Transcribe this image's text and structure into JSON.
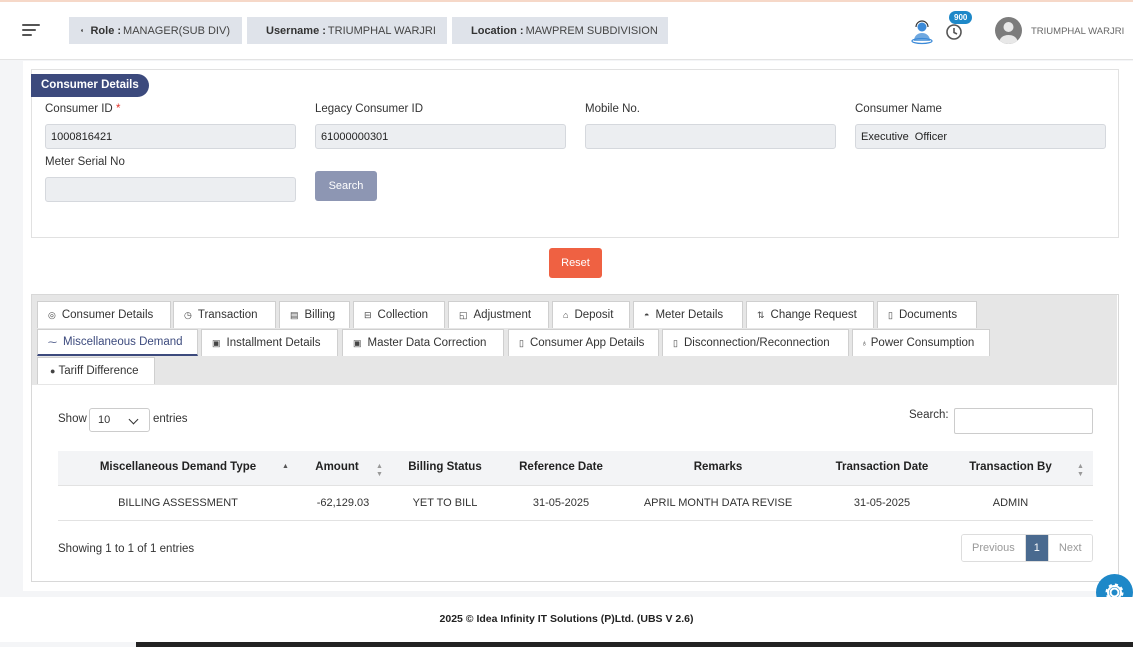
{
  "header": {
    "role_label": "Role :",
    "role_value": "MANAGER(SUB DIV)",
    "username_label": "Username :",
    "username_value": "TRIUMPHAL WARJRI",
    "location_label": "Location :",
    "location_value": "MAWPREM SUBDIVISION",
    "notification_count": "900",
    "user_display": "TRIUMPHAL WARJRI"
  },
  "consumer_details": {
    "title": "Consumer Details",
    "consumer_id_label": "Consumer ID",
    "consumer_id_required": "*",
    "consumer_id_value": "1000816421",
    "legacy_id_label": "Legacy Consumer ID",
    "legacy_id_value": "61000000301",
    "mobile_label": "Mobile No.",
    "mobile_value": "",
    "name_label": "Consumer Name",
    "name_value": "Executive  Officer",
    "meter_label": "Meter Serial No",
    "meter_value": "",
    "search_button": "Search",
    "reset_button": "Reset"
  },
  "tabs": [
    {
      "label": "Consumer Details",
      "icon": "◎"
    },
    {
      "label": "Transaction",
      "icon": "◷"
    },
    {
      "label": "Billing",
      "icon": "▤"
    },
    {
      "label": "Collection",
      "icon": "⊟"
    },
    {
      "label": "Adjustment",
      "icon": "◱"
    },
    {
      "label": "Deposit",
      "icon": "⌂"
    },
    {
      "label": "Meter Details",
      "icon": "◓"
    },
    {
      "label": "Change Request",
      "icon": "⇅"
    },
    {
      "label": "Documents",
      "icon": "▯"
    },
    {
      "label": "Miscellaneous Demand",
      "icon": "⁓",
      "active": true
    },
    {
      "label": "Installment Details",
      "icon": "▣"
    },
    {
      "label": "Master Data Correction",
      "icon": "▣"
    },
    {
      "label": "Consumer App Details",
      "icon": "▯"
    },
    {
      "label": "Disconnection/Reconnection",
      "icon": "▯"
    },
    {
      "label": "Power Consumption",
      "icon": "♁"
    },
    {
      "label": "Tariff Difference",
      "icon": "●"
    }
  ],
  "table": {
    "show_label": "Show",
    "entries_value": "10",
    "entries_label": "entries",
    "search_label": "Search:",
    "search_value": "",
    "columns": [
      "Miscellaneous Demand Type",
      "Amount",
      "Billing Status",
      "Reference Date",
      "Remarks",
      "Transaction Date",
      "Transaction By"
    ],
    "rows": [
      [
        "BILLING ASSESSMENT",
        "-62,129.03",
        "YET TO BILL",
        "31-05-2025",
        "APRIL MONTH DATA REVISE",
        "31-05-2025",
        "ADMIN"
      ]
    ],
    "info": "Showing 1 to 1 of 1 entries",
    "pagination": {
      "previous": "Previous",
      "current": "1",
      "next": "Next"
    }
  },
  "footer": {
    "text": "2025 © Idea Infinity IT Solutions (P)Ltd. (UBS V 2.6)"
  },
  "colors": {
    "primary": "#3c4a7d",
    "reset": "#ef6142",
    "search": "#8d96b3",
    "accent": "#1e88c8"
  }
}
